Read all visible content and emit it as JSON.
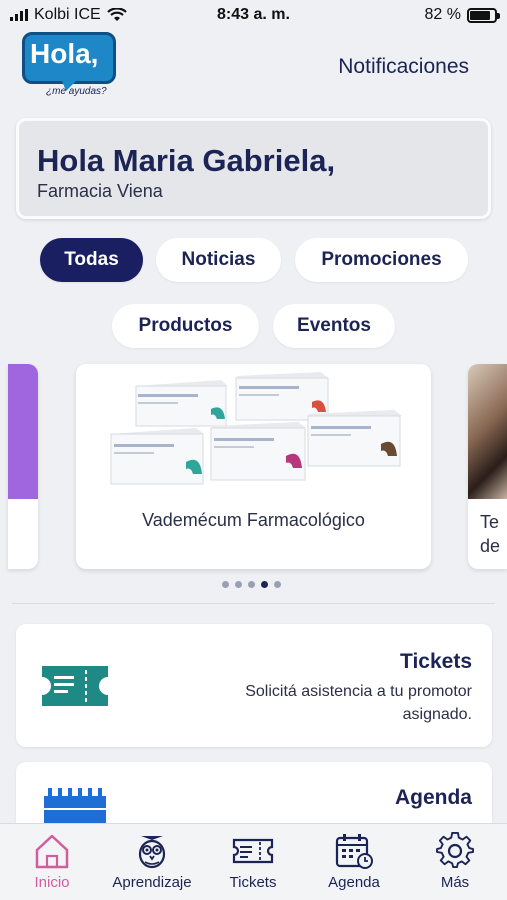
{
  "status_bar": {
    "carrier": "Kolbi ICE",
    "time": "8:43 a. m.",
    "battery": "82 %",
    "battery_level": 0.82
  },
  "header": {
    "logo_text": "Hola,",
    "logo_subtext": "¿me ayudas?",
    "notifications_label": "Notificaciones"
  },
  "greeting": {
    "title": "Hola Maria Gabriela,",
    "subtitle": "Farmacia Viena"
  },
  "filters": [
    {
      "label": "Todas",
      "active": true
    },
    {
      "label": "Noticias",
      "active": false
    },
    {
      "label": "Promociones",
      "active": false
    },
    {
      "label": "Productos",
      "active": false
    },
    {
      "label": "Eventos",
      "active": false
    }
  ],
  "carousel": {
    "main_caption": "Vademécum Farmacológico",
    "next_caption_partial": "Te de",
    "page_count": 5,
    "active_page": 4
  },
  "cards": {
    "tickets": {
      "title": "Tickets",
      "description": "Solicitá asistencia a tu promotor asignado."
    },
    "agenda": {
      "title": "Agenda"
    }
  },
  "tabbar": [
    {
      "label": "Inicio",
      "icon": "home-icon",
      "active": true
    },
    {
      "label": "Aprendizaje",
      "icon": "owl-icon",
      "active": false
    },
    {
      "label": "Tickets",
      "icon": "ticket-icon",
      "active": false
    },
    {
      "label": "Agenda",
      "icon": "calendar-icon",
      "active": false
    },
    {
      "label": "Más",
      "icon": "gear-icon",
      "active": false
    }
  ],
  "colors": {
    "primary": "#1a1f62",
    "active_tab": "#d25ca0",
    "ticket_icon": "#1f8a85",
    "calendar_icon": "#1d6fd6",
    "promo_purple": "#a066e0"
  }
}
